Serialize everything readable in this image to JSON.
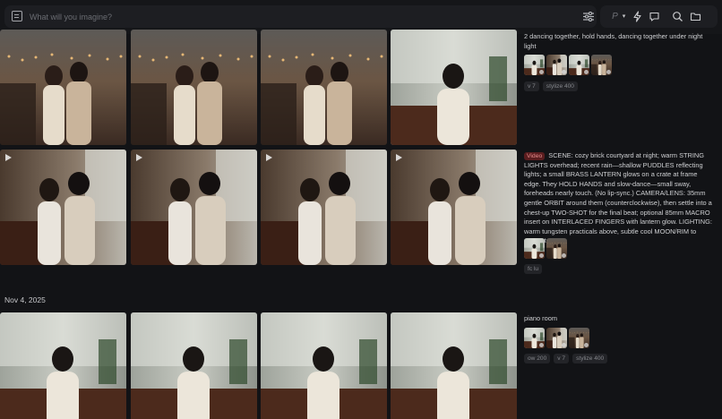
{
  "prompt_bar": {
    "placeholder": "What will you imagine?"
  },
  "toolbar": {
    "icons": [
      "sliders-icon",
      "personalize-icon",
      "chevron-down-icon",
      "lightning-icon",
      "chat-icon",
      "search-icon",
      "folder-icon"
    ]
  },
  "groups": [
    {
      "caption": "2 dancing together, hold hands, dancing together under night light",
      "chips": [
        "v 7",
        "stylize 400"
      ],
      "is_video": false,
      "minis": 4
    },
    {
      "video_tag": "Video",
      "caption": "SCENE: cozy brick courtyard at night; warm STRING LIGHTS overhead; recent rain—shallow PUDDLES reflecting lights; a small BRASS LANTERN glows on a crate at frame edge. They HOLD HANDS and slow-dance—small sway, foreheads nearly touch. (No lip-sync.) CAMERA/LENS: 35mm gentle ORBIT around them (counterclockwise), then settle into a chest-up TWO-SHOT for the final beat; optional 85mm MACRO insert on INTERLACED FINGERS with lantern glow. LIGHTING: warm tungsten practicals above, subtle cool MOON/RIM to separate...",
      "chips": [
        "fc lu"
      ],
      "is_video": true,
      "minis": 2
    },
    {
      "date": "Nov 4, 2025",
      "caption": "piano room",
      "chips": [
        "ow 200",
        "v 7",
        "stylize 400"
      ],
      "is_video": false,
      "minis": 3
    }
  ],
  "colors": {
    "background": "#121316",
    "video_tag_bg": "#5a1d1f",
    "video_tag_text": "#e38c8c",
    "chip_bg": "#232428"
  }
}
